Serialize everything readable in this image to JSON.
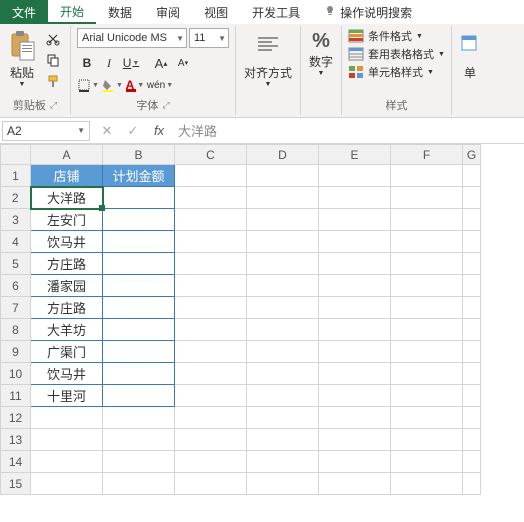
{
  "tabs": {
    "file": "文件",
    "home": "开始",
    "data": "数据",
    "review": "审阅",
    "view": "视图",
    "dev": "开发工具",
    "help": "操作说明搜索"
  },
  "ribbon": {
    "clipboard": {
      "paste": "粘贴",
      "label": "剪贴板"
    },
    "font": {
      "name": "Arial Unicode MS",
      "size": "11",
      "label": "字体",
      "wen": "wén"
    },
    "align": {
      "label": "对齐方式"
    },
    "number": {
      "symbol": "%",
      "label": "数字"
    },
    "styles": {
      "cond": "条件格式",
      "table": "套用表格格式",
      "cell": "单元格样式",
      "label": "样式"
    },
    "cells": {
      "label": "单"
    }
  },
  "namebox": "A2",
  "formula_hint": "大洋路",
  "headers": {
    "A": "店铺",
    "B": "计划金额"
  },
  "rows": [
    "大洋路",
    "左安门",
    "饮马井",
    "方庄路",
    "潘家园",
    "方庄路",
    "大羊坊",
    "广渠门",
    "饮马井",
    "十里河"
  ],
  "cols": [
    "A",
    "B",
    "C",
    "D",
    "E",
    "F",
    "G"
  ]
}
